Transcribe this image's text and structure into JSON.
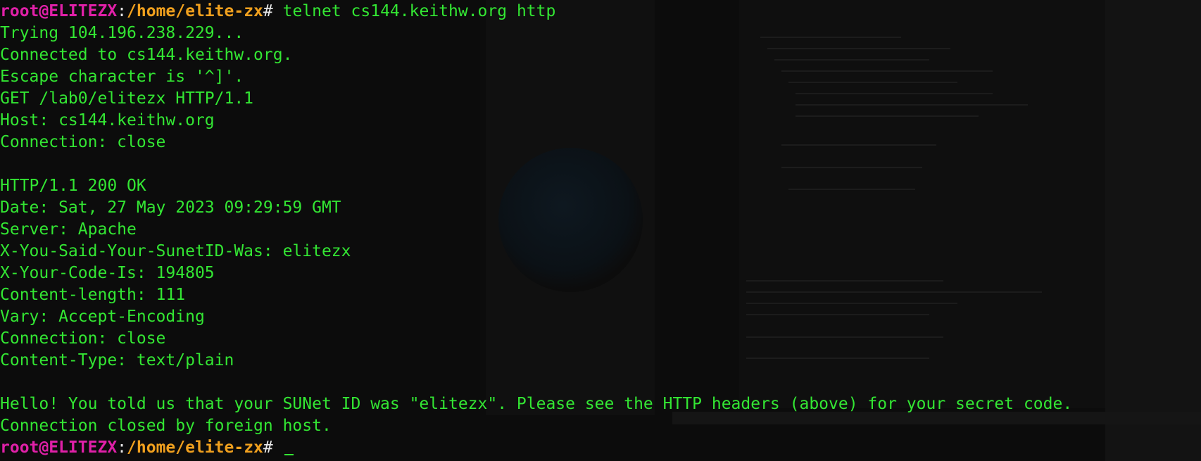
{
  "terminal": {
    "prompt": {
      "user_host": "root@ELITEZX",
      "colon": ":",
      "path": "/home/elite-zx",
      "symbol": "# "
    },
    "command": "telnet cs144.keithw.org http",
    "output_block_1": [
      "Trying 104.196.238.229...",
      "Connected to cs144.keithw.org.",
      "Escape character is '^]'.",
      "GET /lab0/elitezx HTTP/1.1",
      "Host: cs144.keithw.org",
      "Connection: close"
    ],
    "output_block_2": [
      "HTTP/1.1 200 OK",
      "Date: Sat, 27 May 2023 09:29:59 GMT",
      "Server: Apache",
      "X-You-Said-Your-SunetID-Was: elitezx",
      "X-Your-Code-Is: 194805",
      "Content-length: 111",
      "Vary: Accept-Encoding",
      "Connection: close",
      "Content-Type: text/plain"
    ],
    "output_block_3": [
      "Hello! You told us that your SUNet ID was \"elitezx\". Please see the HTTP headers (above) for your secret code.",
      "Connection closed by foreign host."
    ],
    "colors": {
      "background": "#0c0c0c",
      "text_green": "#33e633",
      "prompt_user": "#e020a8",
      "prompt_path": "#f0a01e"
    }
  }
}
